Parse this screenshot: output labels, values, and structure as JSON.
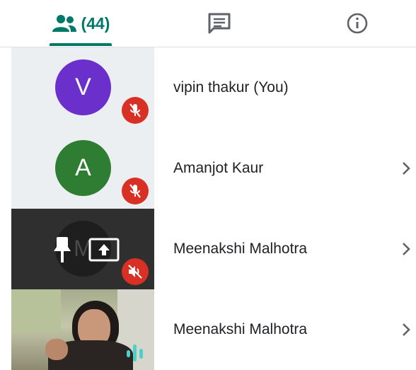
{
  "tabs": {
    "people": {
      "icon": "people-icon",
      "count": "(44)"
    },
    "chat": {
      "icon": "chat-icon"
    },
    "info": {
      "icon": "info-icon"
    }
  },
  "colors": {
    "accent": "#00796b",
    "mute": "#d93025",
    "avatar_v": "#6b2fcb",
    "avatar_a": "#2e7d32"
  },
  "participants": [
    {
      "initial": "V",
      "name": "vipin thakur (You)",
      "muted": true
    },
    {
      "initial": "A",
      "name": "Amanjot Kaur",
      "muted": true
    },
    {
      "initial": "M",
      "name": "Meenakshi Malhotra",
      "audio_muted": true
    },
    {
      "name": "Meenakshi Malhotra",
      "speaking": true
    }
  ]
}
